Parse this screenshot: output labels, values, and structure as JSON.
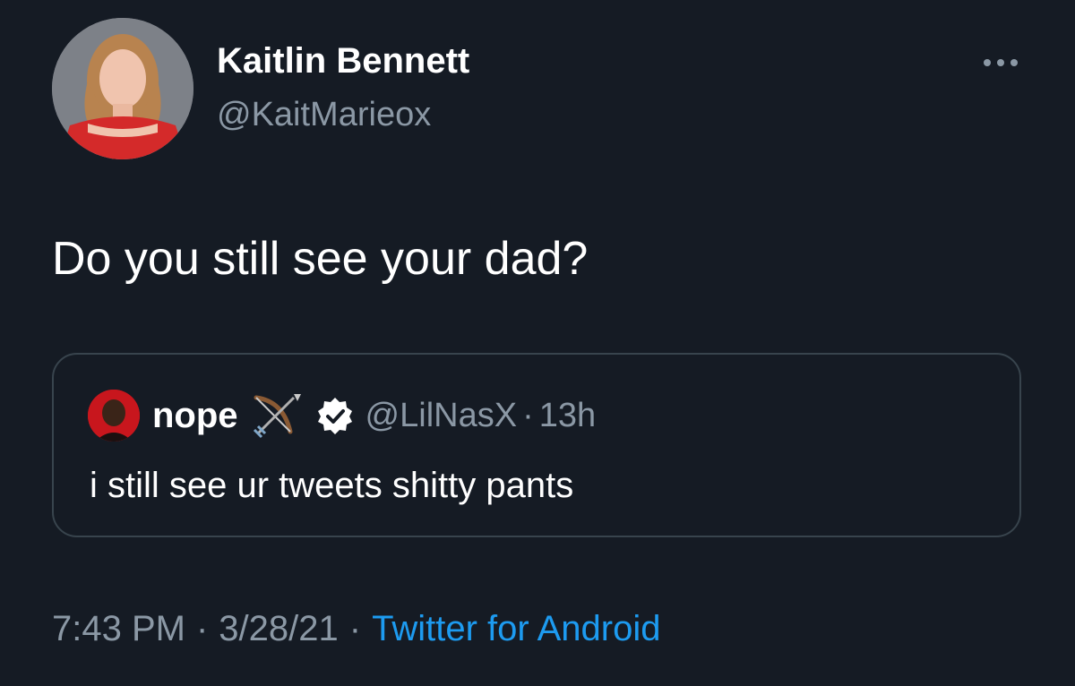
{
  "tweet": {
    "author": {
      "display_name": "Kaitlin Bennett",
      "handle": "@KaitMarieox"
    },
    "text": "Do you still see your dad?",
    "time": "7:43 PM",
    "date": "3/28/21",
    "separator": "·",
    "source": "Twitter for Android"
  },
  "quoted_tweet": {
    "display_name": "nope",
    "handle": "@LilNasX",
    "separator": "·",
    "age": "13h",
    "text": "i still see ur tweets shitty pants"
  },
  "icons": {
    "more": "more-horizontal-icon",
    "emoji": "bow-and-arrow-icon",
    "verified": "verified-badge-icon"
  },
  "colors": {
    "background": "#151b24",
    "primary_text": "#ffffff",
    "secondary_text": "#8b98a5",
    "link": "#1d9bf0",
    "border": "#38444d"
  }
}
